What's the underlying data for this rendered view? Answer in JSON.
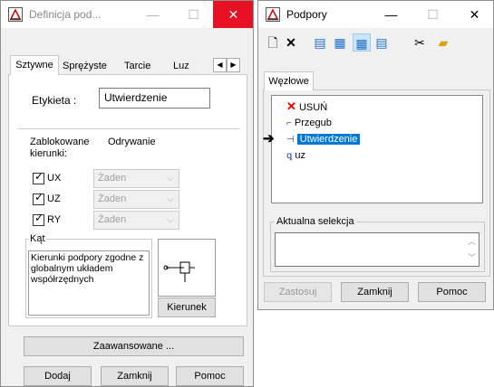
{
  "left_window": {
    "title": "Definicja pod...",
    "tabs": [
      "Sztywne",
      "Sprężyste",
      "Tarcie",
      "Luz"
    ],
    "label_field_caption": "Etykieta :",
    "label_field_value": "Utwierdzenie",
    "blocked_header": "Zablokowane\nkierunki:",
    "release_header": "Odrywanie",
    "directions": [
      {
        "label": "UX",
        "option": "Żaden"
      },
      {
        "label": "UZ",
        "option": "Żaden"
      },
      {
        "label": "RY",
        "option": "Żaden"
      }
    ],
    "angle_group_title": "Kąt",
    "angle_text": "Kierunki podpory zgodne z globalnym układem współrzędnych",
    "direction_button": "Kierunek",
    "advanced_button": "Zaawansowane ...",
    "add_button": "Dodaj",
    "close_button": "Zamknij",
    "help_button": "Pomoc"
  },
  "right_window": {
    "title": "Podpory",
    "tab": "Węzłowe",
    "tree": [
      {
        "label": "USUŃ",
        "icon": "red-x-icon"
      },
      {
        "label": "Przegub",
        "icon": "hinge-support-icon"
      },
      {
        "label": "Utwierdzenie",
        "icon": "fixed-support-icon",
        "selected": true
      },
      {
        "label": "uz",
        "icon": "roller-support-icon"
      }
    ],
    "selection_group_title": "Aktualna selekcja",
    "apply_button": "Zastosuj",
    "close_button": "Zamknij",
    "help_button": "Pomoc"
  },
  "colors": {
    "close_red": "#e81123",
    "selection_blue": "#0078d7"
  }
}
